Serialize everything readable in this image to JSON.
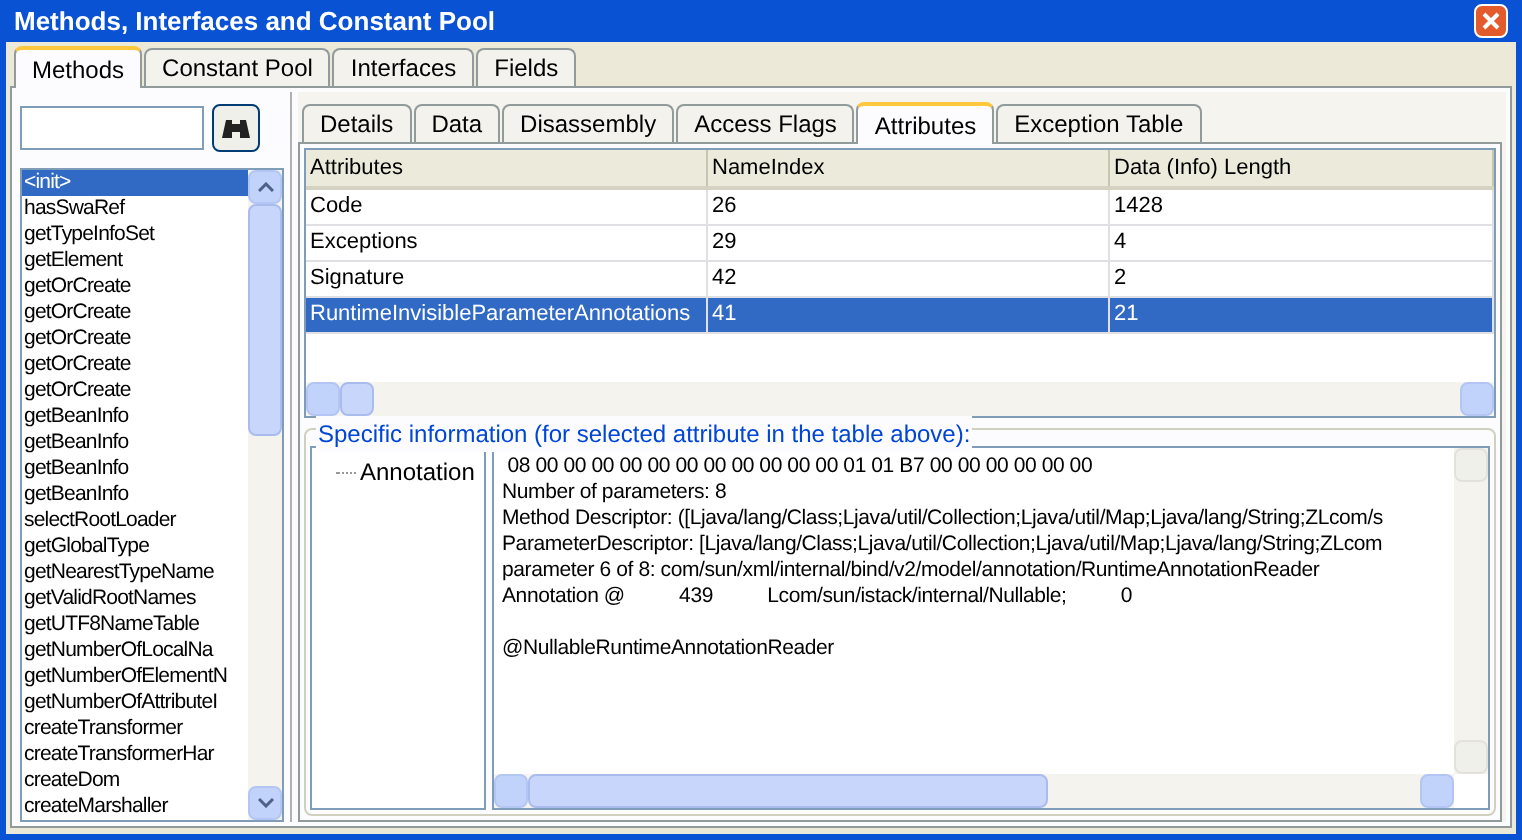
{
  "window": {
    "title": "Methods, Interfaces and Constant Pool"
  },
  "tabs": [
    {
      "label": "Methods",
      "selected": true
    },
    {
      "label": "Constant Pool",
      "selected": false
    },
    {
      "label": "Interfaces",
      "selected": false
    },
    {
      "label": "Fields",
      "selected": false
    }
  ],
  "methods": [
    {
      "label": "<init>",
      "selected": true
    },
    {
      "label": "hasSwaRef",
      "selected": false
    },
    {
      "label": "getTypeInfoSet",
      "selected": false
    },
    {
      "label": "getElement",
      "selected": false
    },
    {
      "label": "getOrCreate",
      "selected": false
    },
    {
      "label": "getOrCreate",
      "selected": false
    },
    {
      "label": "getOrCreate",
      "selected": false
    },
    {
      "label": "getOrCreate",
      "selected": false
    },
    {
      "label": "getOrCreate",
      "selected": false
    },
    {
      "label": "getBeanInfo",
      "selected": false
    },
    {
      "label": "getBeanInfo",
      "selected": false
    },
    {
      "label": "getBeanInfo",
      "selected": false
    },
    {
      "label": "getBeanInfo",
      "selected": false
    },
    {
      "label": "selectRootLoader",
      "selected": false
    },
    {
      "label": "getGlobalType",
      "selected": false
    },
    {
      "label": "getNearestTypeName",
      "selected": false
    },
    {
      "label": "getValidRootNames",
      "selected": false
    },
    {
      "label": "getUTF8NameTable",
      "selected": false
    },
    {
      "label": "getNumberOfLocalNa",
      "selected": false
    },
    {
      "label": "getNumberOfElementN",
      "selected": false
    },
    {
      "label": "getNumberOfAttributeI",
      "selected": false
    },
    {
      "label": "createTransformer",
      "selected": false
    },
    {
      "label": "createTransformerHar",
      "selected": false
    },
    {
      "label": "createDom",
      "selected": false
    },
    {
      "label": "createMarshaller",
      "selected": false
    }
  ],
  "detail_tabs": [
    {
      "label": "Details",
      "selected": false
    },
    {
      "label": "Data",
      "selected": false
    },
    {
      "label": "Disassembly",
      "selected": false
    },
    {
      "label": "Access Flags",
      "selected": false
    },
    {
      "label": "Attributes",
      "selected": true
    },
    {
      "label": "Exception Table",
      "selected": false
    }
  ],
  "table": {
    "columns": [
      "Attributes",
      "NameIndex",
      "Data (Info) Length"
    ],
    "rows": [
      {
        "cells": [
          "Code",
          "26",
          "1428"
        ],
        "selected": false
      },
      {
        "cells": [
          "Exceptions",
          "29",
          "4"
        ],
        "selected": false
      },
      {
        "cells": [
          "Signature",
          "42",
          "2"
        ],
        "selected": false
      },
      {
        "cells": [
          "RuntimeInvisibleParameterAnnotations",
          "41",
          "21"
        ],
        "selected": true
      }
    ]
  },
  "specific_info": {
    "title": "Specific information (for selected attribute in the table above):",
    "tree": [
      {
        "label": "Annotation"
      }
    ],
    "lines": [
      {
        "text": " 08 00 00 00 00 00 00 00 00 00 00 00 01 01 B7 00 00 00 00 00 00",
        "gap_before": false
      },
      {
        "text": "Number of parameters: 8",
        "gap_before": false
      },
      {
        "text": "Method Descriptor: ([Ljava/lang/Class;Ljava/util/Collection;Ljava/util/Map;Ljava/lang/String;ZLcom/s",
        "gap_before": false
      },
      {
        "text": "ParameterDescriptor: [Ljava/lang/Class;Ljava/util/Collection;Ljava/util/Map;Ljava/lang/String;ZLcom",
        "gap_before": false
      },
      {
        "text": "parameter 6 of 8: com/sun/xml/internal/bind/v2/model/annotation/RuntimeAnnotationReader",
        "gap_before": false
      },
      {
        "text": "Annotation @          439          Lcom/sun/istack/internal/Nullable;          0",
        "gap_before": false
      },
      {
        "text": "@NullableRuntimeAnnotationReader",
        "gap_before": true
      }
    ]
  }
}
